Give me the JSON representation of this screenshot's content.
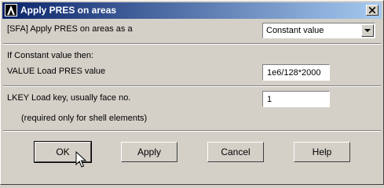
{
  "window": {
    "title": "Apply PRES on areas",
    "logo_icon": "ansys-logo-icon",
    "close_icon": "close-icon"
  },
  "row1": {
    "label": "[SFA]  Apply PRES on areas as a",
    "select_value": "Constant value"
  },
  "section": {
    "heading": "If Constant value then:"
  },
  "row2": {
    "label": "VALUE  Load PRES value",
    "value": "1e6/128*2000"
  },
  "row3": {
    "label": "LKEY  Load key, usually face no.",
    "value": "1",
    "note": "(required only for shell elements)"
  },
  "buttons": {
    "ok": "OK",
    "apply": "Apply",
    "cancel": "Cancel",
    "help": "Help"
  }
}
